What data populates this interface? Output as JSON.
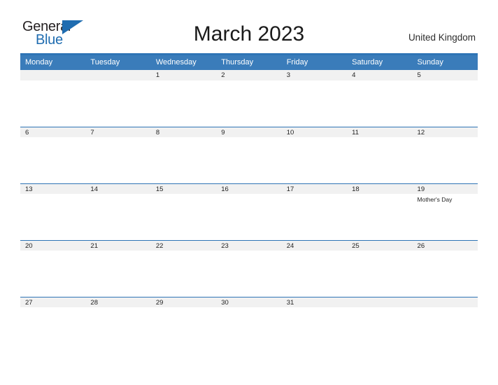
{
  "logo": {
    "word_one": "General",
    "word_two": "Blue",
    "triangle_icon": "triangle-icon",
    "brand_blue": "#1f6cb0"
  },
  "header": {
    "title": "March 2023",
    "locale": "United Kingdom"
  },
  "colors": {
    "header_row_blue": "#3a7cba",
    "rule_blue": "#2e74b5",
    "day_band_gray": "#f1f1f1",
    "text": "#222222"
  },
  "calendar": {
    "weekday_headers": [
      "Monday",
      "Tuesday",
      "Wednesday",
      "Thursday",
      "Friday",
      "Saturday",
      "Sunday"
    ],
    "weeks": [
      [
        {
          "day": "",
          "events": []
        },
        {
          "day": "",
          "events": []
        },
        {
          "day": "1",
          "events": []
        },
        {
          "day": "2",
          "events": []
        },
        {
          "day": "3",
          "events": []
        },
        {
          "day": "4",
          "events": []
        },
        {
          "day": "5",
          "events": []
        }
      ],
      [
        {
          "day": "6",
          "events": []
        },
        {
          "day": "7",
          "events": []
        },
        {
          "day": "8",
          "events": []
        },
        {
          "day": "9",
          "events": []
        },
        {
          "day": "10",
          "events": []
        },
        {
          "day": "11",
          "events": []
        },
        {
          "day": "12",
          "events": []
        }
      ],
      [
        {
          "day": "13",
          "events": []
        },
        {
          "day": "14",
          "events": []
        },
        {
          "day": "15",
          "events": []
        },
        {
          "day": "16",
          "events": []
        },
        {
          "day": "17",
          "events": []
        },
        {
          "day": "18",
          "events": []
        },
        {
          "day": "19",
          "events": [
            "Mother's Day"
          ]
        }
      ],
      [
        {
          "day": "20",
          "events": []
        },
        {
          "day": "21",
          "events": []
        },
        {
          "day": "22",
          "events": []
        },
        {
          "day": "23",
          "events": []
        },
        {
          "day": "24",
          "events": []
        },
        {
          "day": "25",
          "events": []
        },
        {
          "day": "26",
          "events": []
        }
      ],
      [
        {
          "day": "27",
          "events": []
        },
        {
          "day": "28",
          "events": []
        },
        {
          "day": "29",
          "events": []
        },
        {
          "day": "30",
          "events": []
        },
        {
          "day": "31",
          "events": []
        },
        {
          "day": "",
          "events": []
        },
        {
          "day": "",
          "events": []
        }
      ]
    ]
  }
}
